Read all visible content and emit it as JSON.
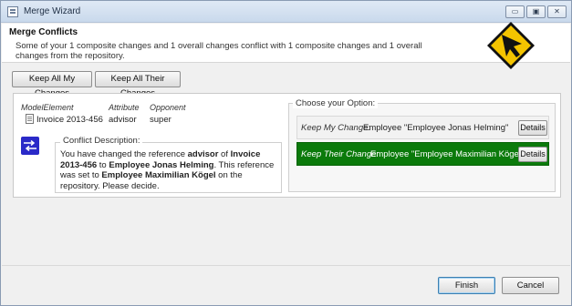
{
  "window": {
    "title": "Merge Wizard",
    "min_glyph": "▭",
    "max_glyph": "▣",
    "close_glyph": "✕"
  },
  "header": {
    "title": "Merge Conflicts",
    "message": "Some of your 1 composite changes and 1 overall changes conflict with 1 composite changes and 1 overall changes from the repository."
  },
  "toolbar": {
    "keep_mine_label": "Keep All My Changes",
    "keep_theirs_label": "Keep All Their Changes"
  },
  "conflict": {
    "columns": {
      "model_element": "ModelElement",
      "attribute": "Attribute",
      "opponent": "Opponent"
    },
    "row": {
      "model_element": "Invoice 2013-456",
      "attribute": "advisor",
      "opponent": "super"
    },
    "description_legend": "Conflict Description:",
    "description": {
      "t1": "You have changed the reference ",
      "b1": "advisor",
      "t2": " of ",
      "b2": "Invoice 2013-456",
      "t3": " to ",
      "b3": "Employee Jonas Helming",
      "t4": ". This reference was set to ",
      "b4": "Employee Maximilian Kögel",
      "t5": " on the repository. Please decide."
    }
  },
  "options": {
    "legend": "Choose your Option:",
    "mine": {
      "label": "Keep My Change:",
      "value": "Employee \"Employee Jonas Helming\"",
      "details_label": "Details",
      "selected": false
    },
    "theirs": {
      "label": "Keep Their Change:",
      "value": "Employee \"Employee Maximilian Kögel\"",
      "details_label": "Details",
      "selected": true,
      "highlight_color": "#0b7a0b"
    }
  },
  "footer": {
    "finish_label": "Finish",
    "cancel_label": "Cancel"
  },
  "icons": {
    "app": "window-icon",
    "wizard": "cursor-sign-icon",
    "conflict": "conflict-arrows-icon",
    "document": "document-icon"
  }
}
